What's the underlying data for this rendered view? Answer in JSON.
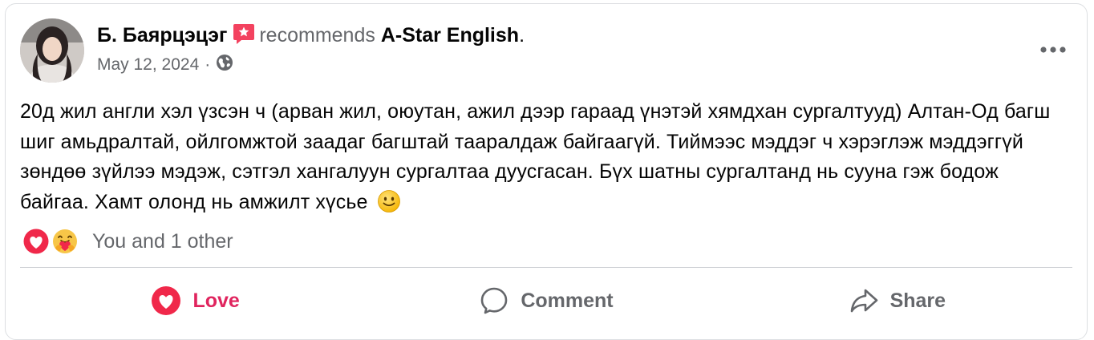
{
  "post": {
    "author": "Б. Баярцэцэг",
    "recommend_text": "recommends",
    "page_name": "A-Star English",
    "period": ".",
    "date": "May 12, 2024",
    "separator": "·",
    "privacy_icon": "globe-icon",
    "more_icon": "more-horizontal-icon",
    "text": "20д жил англи хэл үзсэн ч (арван жил, оюутан, ажил дээр гараад үнэтэй хямдхан сургалтууд) Алтан-Од багш шиг амьдралтай, ойлгомжтой заадаг багштай таарaлдаж байгаагүй. Тиймээс мэддэг ч хэрэглэж мэддэггүй зөндөө зүйлээ мэдэж, сэтгэл хангалуун сургалтаа дуусгасан. Бүх шатны сургалтанд нь сууна гэж бодож байгаа. Хамт олонд нь амжилт хүсье",
    "emoji": "slightly-smiling-face"
  },
  "reactions": {
    "icons": [
      "love-reaction-icon",
      "care-reaction-icon"
    ],
    "count_text": "You and 1 other"
  },
  "actions": {
    "love_label": "Love",
    "comment_label": "Comment",
    "share_label": "Share"
  },
  "colors": {
    "love": "#e0245e",
    "muted": "#65676b",
    "recommend_badge": "#f3425f"
  }
}
